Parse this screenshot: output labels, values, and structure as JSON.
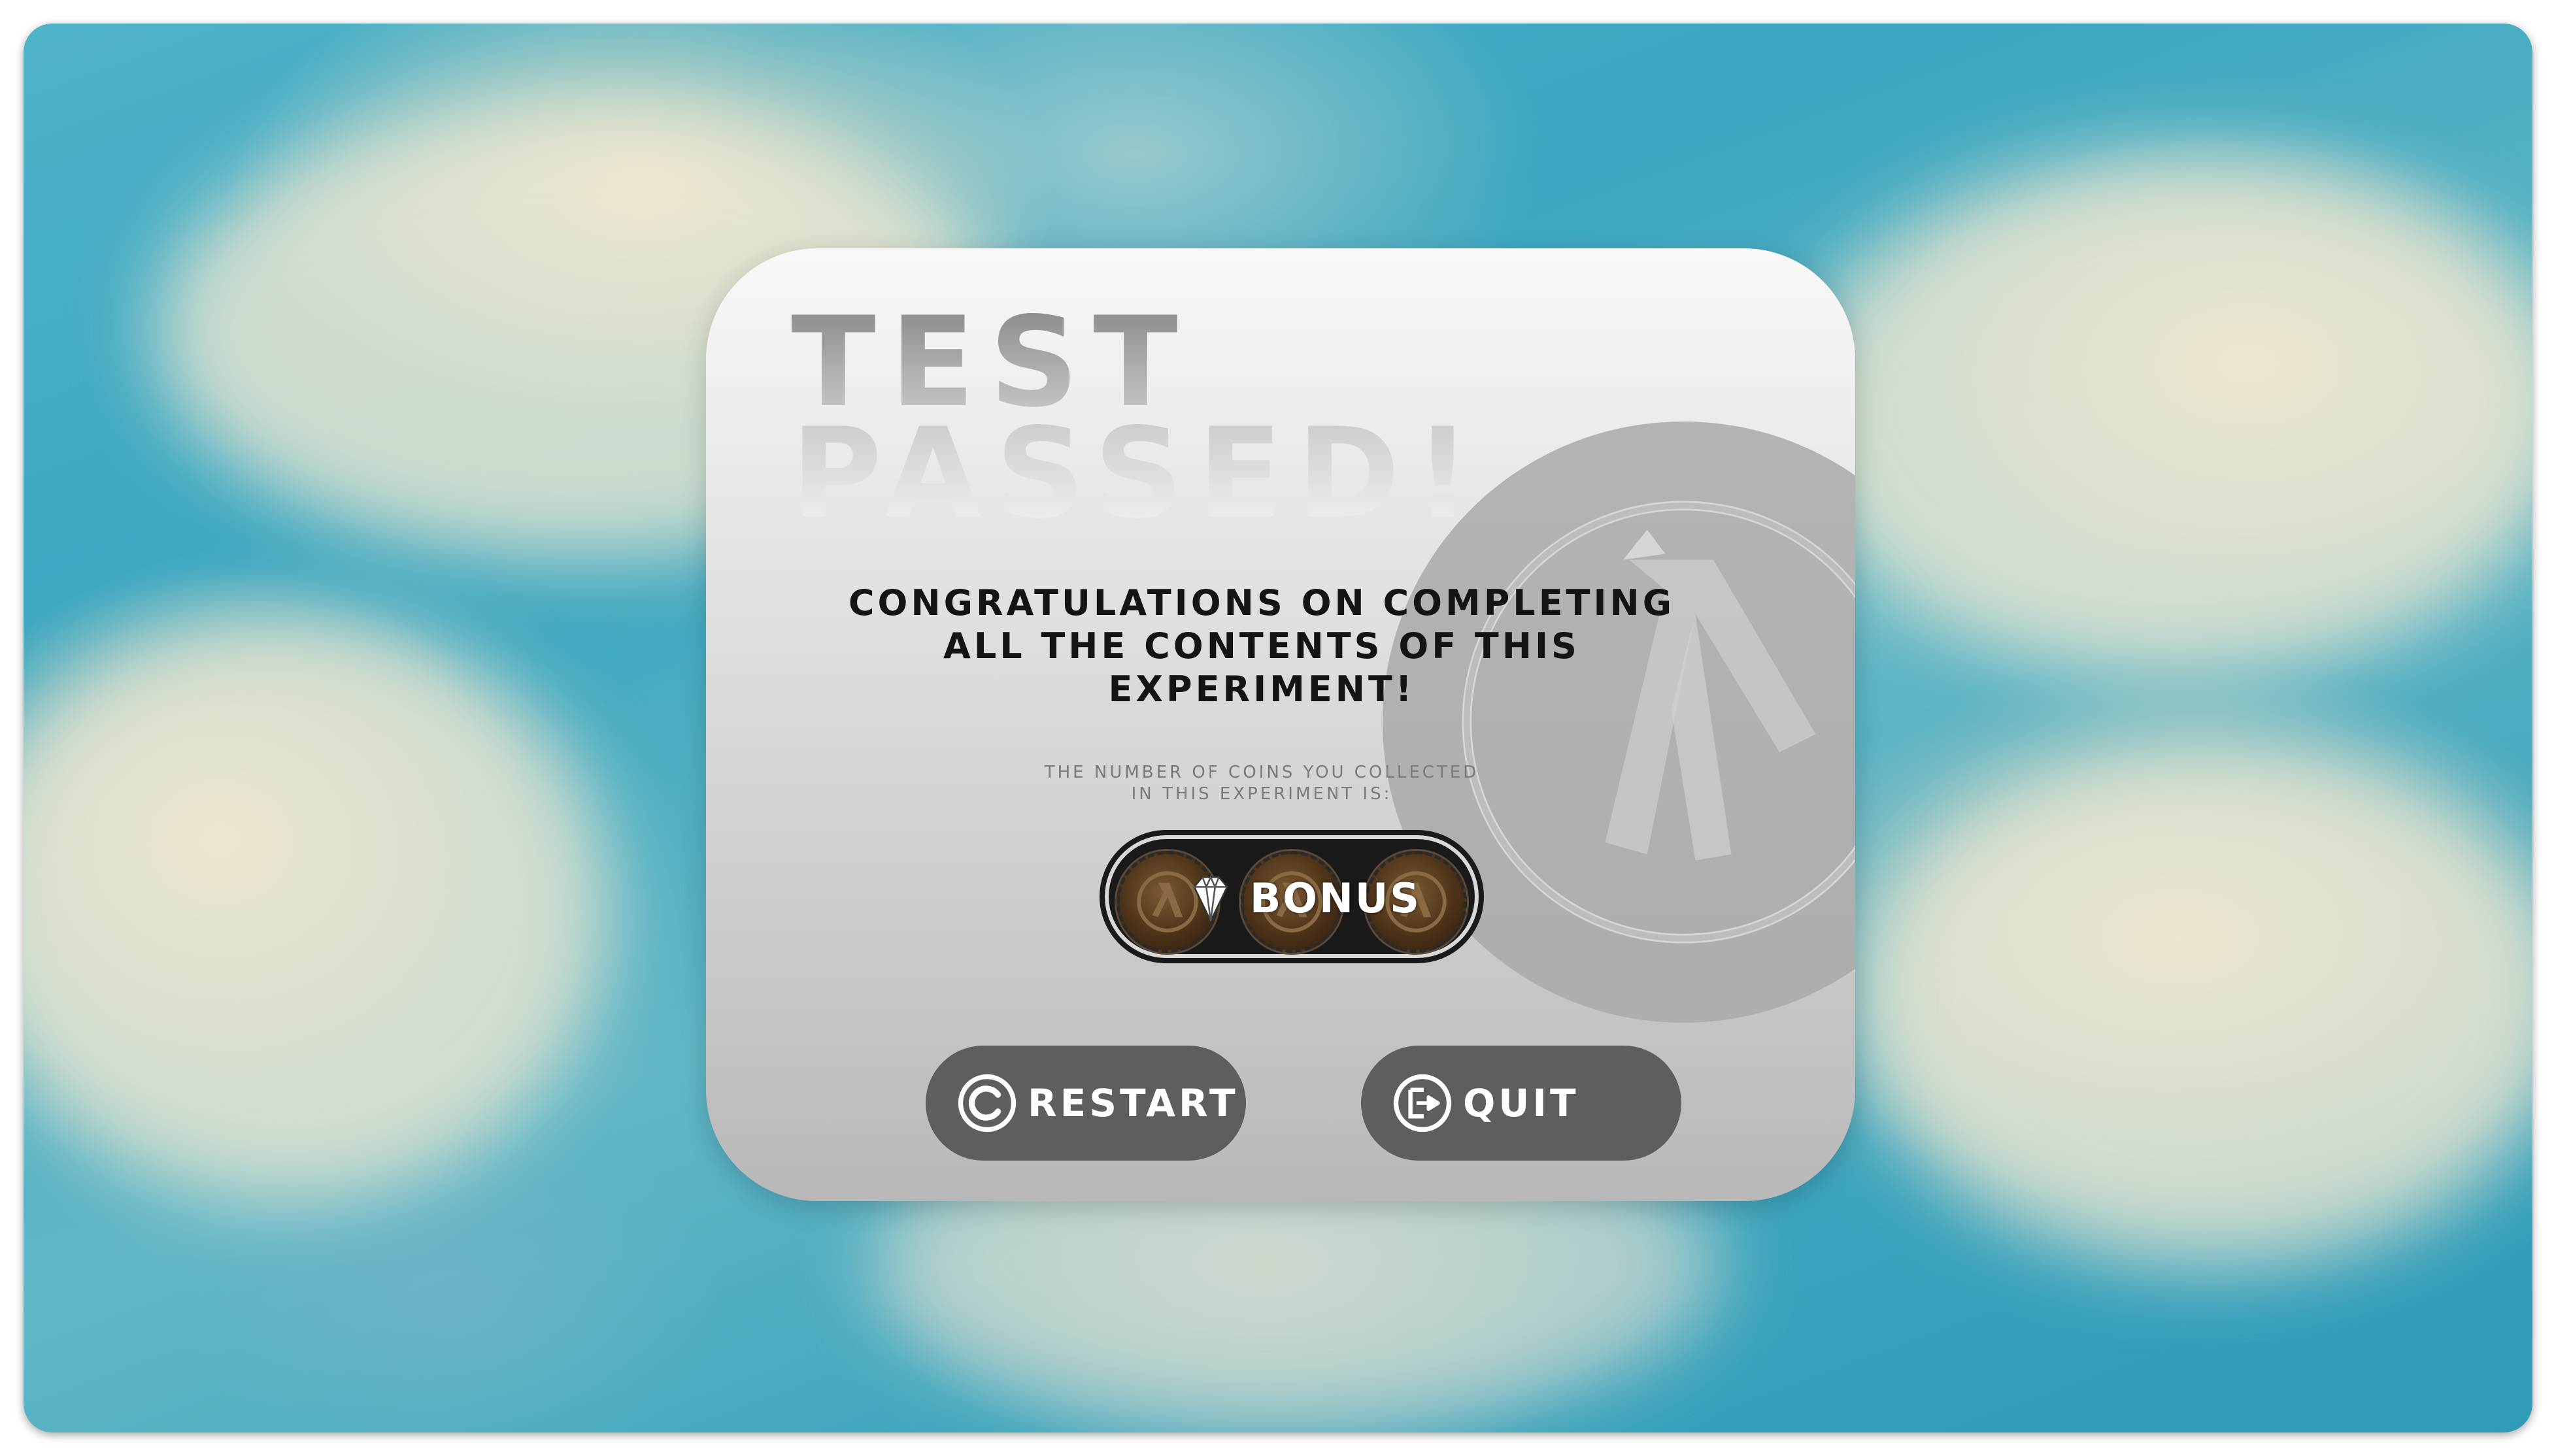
{
  "dialog": {
    "title_line1": "TEST",
    "title_line2": "PASSED!",
    "message": "CONGRATULATIONS ON COMPLETING ALL THE CONTENTS OF THIS EXPERIMENT!",
    "coins_caption_line1": "THE NUMBER OF COINS YOU COLLECTED",
    "coins_caption_line2": "IN THIS EXPERIMENT IS:",
    "bonus_label": "BONUS",
    "coin_count_shown": 3
  },
  "buttons": {
    "restart_label": "RESTART",
    "quit_label": "QUIT"
  },
  "icons": {
    "watermark": "half-life-lambda-logo",
    "bonus": "diamond-icon",
    "restart": "copyright-restart-icon",
    "quit": "exit-door-arrow-icon",
    "coin": "lambda-coin-icon"
  },
  "colors": {
    "panel_top": "#f8f8f8",
    "panel_bottom": "#b8b8b8",
    "button_bg": "#5e5e5e",
    "button_text": "#ffffff",
    "title_gradient_dark": "#8c8c8c",
    "message_text": "#141414",
    "caption_text": "#7a7a7a",
    "coin_bronze": "#6b4a28",
    "sky_blue": "#3aa6c0",
    "cloud_cream": "#ece2c6"
  }
}
